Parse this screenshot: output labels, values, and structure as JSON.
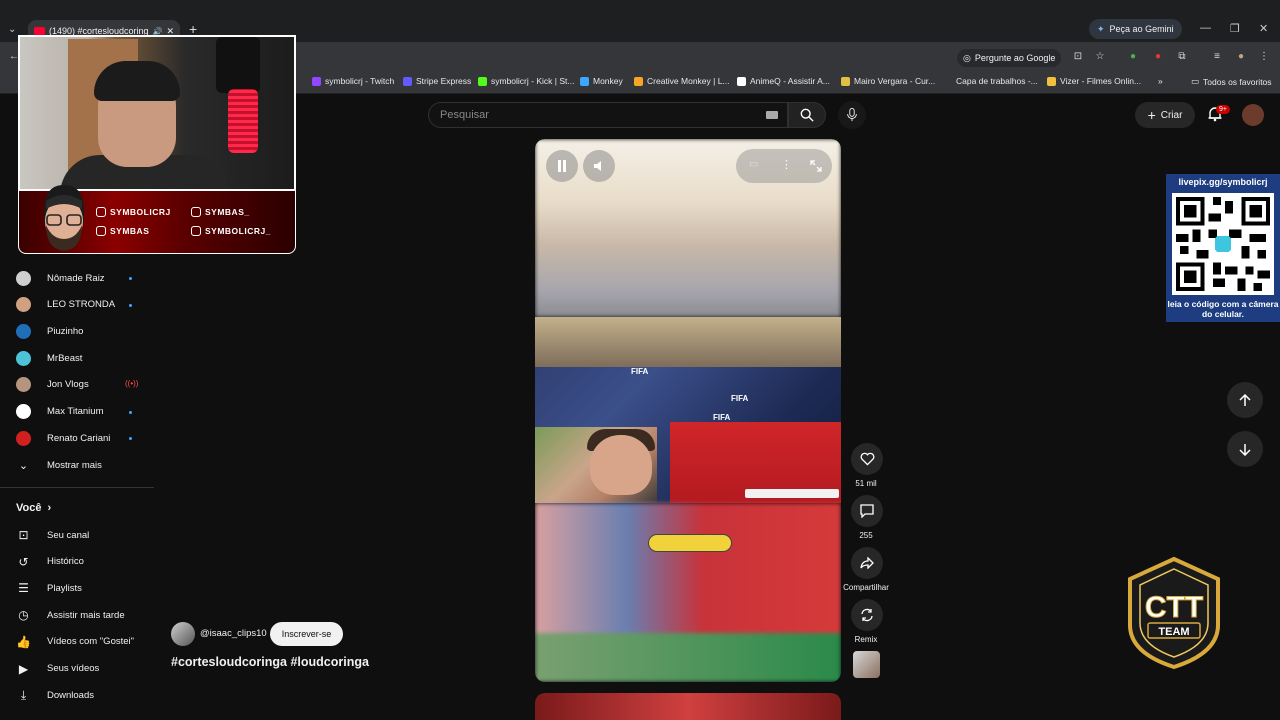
{
  "browser": {
    "tab_title": "(1490) #cortesloudcoringa",
    "gemini_label": "Peça ao Gemini",
    "ask_google_label": "Pergunte ao Google",
    "bookmarks": [
      {
        "label": "symbolicrj - Twitch",
        "color": "#9146ff"
      },
      {
        "label": "Stripe Express",
        "color": "#635bff"
      },
      {
        "label": "symbolicrj - Kick | St...",
        "color": "#53fc18"
      },
      {
        "label": "Monkey",
        "color": "#3ea6ff"
      },
      {
        "label": "Creative Monkey | L...",
        "color": "#f5a623"
      },
      {
        "label": "AnimeQ - Assistir A...",
        "color": "#ffffff"
      },
      {
        "label": "Mairo Vergara - Cur...",
        "color": "#e0c040"
      },
      {
        "label": "Capa de trabalhos -...",
        "color": "#35363a"
      },
      {
        "label": "Vizer - Filmes Onlin...",
        "color": "#f0c040"
      }
    ],
    "all_bookmarks_label": "Todos os favoritos"
  },
  "header": {
    "search_placeholder": "Pesquisar",
    "create_label": "Criar",
    "notifications_badge": "9+"
  },
  "sidebar": {
    "subscriptions": [
      {
        "label": "Nômade Raiz",
        "color": "#cfcfcf",
        "indicator": "dot"
      },
      {
        "label": "LEO STRONDA",
        "color": "#d0a080",
        "indicator": "dot"
      },
      {
        "label": "Piuzinho",
        "color": "#1e6fb8",
        "indicator": "none"
      },
      {
        "label": "MrBeast",
        "color": "#4ec3d8",
        "indicator": "none"
      },
      {
        "label": "Jon Vlogs",
        "color": "#b59580",
        "indicator": "live"
      },
      {
        "label": "Max Titanium",
        "color": "#ffffff",
        "indicator": "dot"
      },
      {
        "label": "Renato Cariani",
        "color": "#d02020",
        "indicator": "dot"
      }
    ],
    "show_more_label": "Mostrar mais",
    "you_label": "Você",
    "you_items": [
      {
        "label": "Seu canal",
        "icon": "channel-icon"
      },
      {
        "label": "Histórico",
        "icon": "history-icon"
      },
      {
        "label": "Playlists",
        "icon": "playlists-icon"
      },
      {
        "label": "Assistir mais tarde",
        "icon": "watch-later-icon"
      },
      {
        "label": "Vídeos com \"Gostei\"",
        "icon": "liked-icon"
      },
      {
        "label": "Seus vídeos",
        "icon": "your-videos-icon"
      },
      {
        "label": "Downloads",
        "icon": "downloads-icon"
      }
    ]
  },
  "overlay": {
    "socials": [
      {
        "label": "SYMBOLICRJ",
        "icon": "twitch-icon"
      },
      {
        "label": "SYMBAS_",
        "icon": "tiktok-icon"
      },
      {
        "label": "SYMBAS",
        "icon": "youtube-icon"
      },
      {
        "label": "SYMBOLICRJ_",
        "icon": "instagram-icon"
      }
    ],
    "qr_url": "livepix.gg/symbolicrj",
    "qr_caption": "leia o código com a câmera do celular.",
    "ctt_label": "TEAM"
  },
  "short": {
    "likes": "51 mil",
    "comments": "255",
    "share_label": "Compartilhar",
    "remix_label": "Remix",
    "channel": "@isaac_clips10",
    "subscribe_label": "Inscrever-se",
    "hashtags": "#cortesloudcoringa #loudcoringa",
    "fifa_text": "FIFA"
  }
}
